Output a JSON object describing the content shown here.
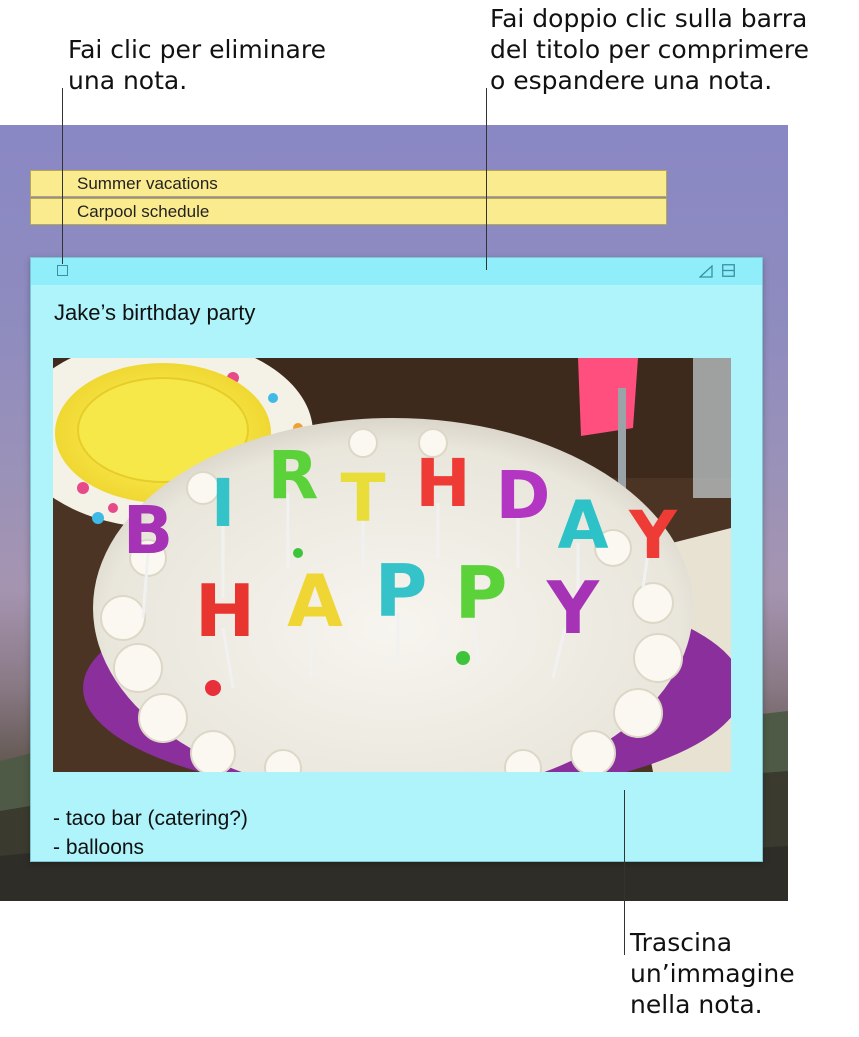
{
  "callouts": {
    "delete_note": [
      "Fai clic per eliminare",
      "una nota."
    ],
    "collapse_expand": [
      "Fai doppio clic sulla barra",
      "del titolo per comprimere",
      "o espandere una nota."
    ],
    "drag_image": [
      "Trascina",
      "un’immagine",
      "nella nota."
    ]
  },
  "notes": {
    "collapsed": [
      {
        "title": "Summer vacations",
        "color": "#fbeb8f"
      },
      {
        "title": "Carpool schedule",
        "color": "#fbeb8f"
      }
    ],
    "active": {
      "color": "#aff3fb",
      "titlebar_color": "#8feef9",
      "title": "Jake’s birthday party",
      "image_subject": "birthday cake with HAPPY BIRTHDAY letter candles",
      "candle_letters": {
        "row1": [
          "B",
          "I",
          "R",
          "T",
          "H",
          "D",
          "A",
          "Y"
        ],
        "row2": [
          "H",
          "A",
          "P",
          "P",
          "Y"
        ]
      },
      "list_items": [
        "- taco bar (catering?)",
        "- balloons"
      ]
    }
  },
  "icons": {
    "close": "close-box-icon",
    "resize": "resize-icon",
    "collapse": "collapse-icon"
  }
}
